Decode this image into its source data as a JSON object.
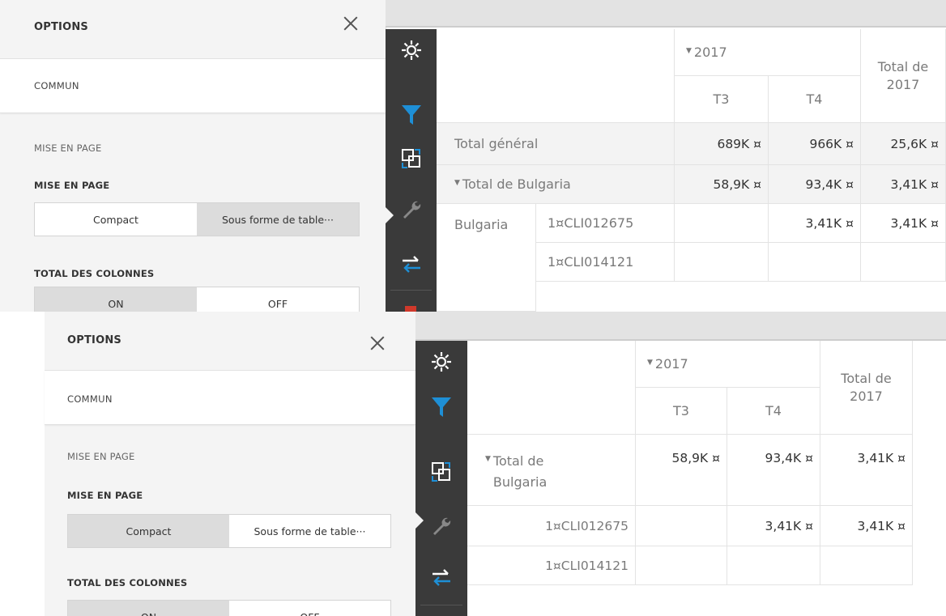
{
  "colors": {
    "accent": "#1e8fd6",
    "toolbar": "#3a3a3a",
    "panel": "#f4f4f4",
    "selected_segment": "#dcdcdc"
  },
  "options": {
    "title": "OPTIONS",
    "tab": "COMMUN",
    "group": "MISE EN PAGE",
    "layout_label": "MISE EN PAGE",
    "layout_compact": "Compact",
    "layout_tabular": "Sous forme de table···",
    "totals_label": "TOTAL DES COLONNES",
    "totals_on": "ON",
    "totals_off": "OFF"
  },
  "toolbar": {
    "icons": [
      "gear-icon",
      "filter-icon",
      "layout-swap-icon",
      "wrench-icon",
      "swap-arrows-icon"
    ]
  },
  "shot1": {
    "layout_selected": "tabular",
    "totals_selected": "on",
    "pivot": {
      "year": "2017",
      "q3": "T3",
      "q4": "T4",
      "total_header": "Total de 2017",
      "grand_total": {
        "label": "Total général",
        "t3": "689K ¤",
        "t4": "966K ¤",
        "total": "25,6K ¤"
      },
      "bulgaria_total": {
        "label": "Total de Bulgaria",
        "t3": "58,9K ¤",
        "t4": "93,4K ¤",
        "total": "3,41K ¤"
      },
      "country": "Bulgaria",
      "rows": [
        {
          "client": "1¤CLI012675",
          "t3": "",
          "t4": "3,41K ¤",
          "total": "3,41K ¤"
        },
        {
          "client": "1¤CLI014121",
          "t3": "",
          "t4": "",
          "total": ""
        }
      ]
    }
  },
  "shot2": {
    "layout_selected": "compact",
    "totals_selected": "on",
    "pivot": {
      "year": "2017",
      "q3": "T3",
      "q4": "T4",
      "total_header": "Total de 2017",
      "bulgaria_total": {
        "label": "Total de Bulgaria",
        "t3": "58,9K ¤",
        "t4": "93,4K ¤",
        "total": "3,41K ¤"
      },
      "rows": [
        {
          "client": "1¤CLI012675",
          "t3": "",
          "t4": "3,41K ¤",
          "total": "3,41K ¤"
        },
        {
          "client": "1¤CLI014121",
          "t3": "",
          "t4": "",
          "total": ""
        }
      ]
    }
  }
}
